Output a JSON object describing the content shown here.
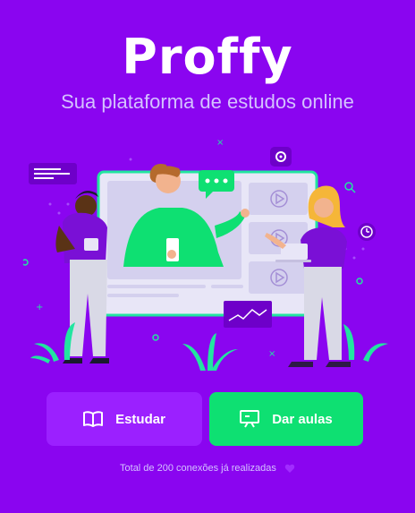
{
  "brand": {
    "logo_text": "Proffy"
  },
  "tagline": "Sua plataforma de estudos online",
  "actions": {
    "study_label": "Estudar",
    "teach_label": "Dar aulas"
  },
  "footer": {
    "connections_text": "Total de 200 conexões já realizadas"
  },
  "colors": {
    "background": "#8a05f0",
    "study_button": "#9b20ff",
    "teach_button": "#0ee072",
    "text_secondary": "#D4C2FF"
  },
  "icons": [
    "book-open-icon",
    "presentation-icon",
    "heart-icon",
    "gear-icon",
    "clock-icon",
    "play-icon",
    "chat-bubble-icon"
  ]
}
